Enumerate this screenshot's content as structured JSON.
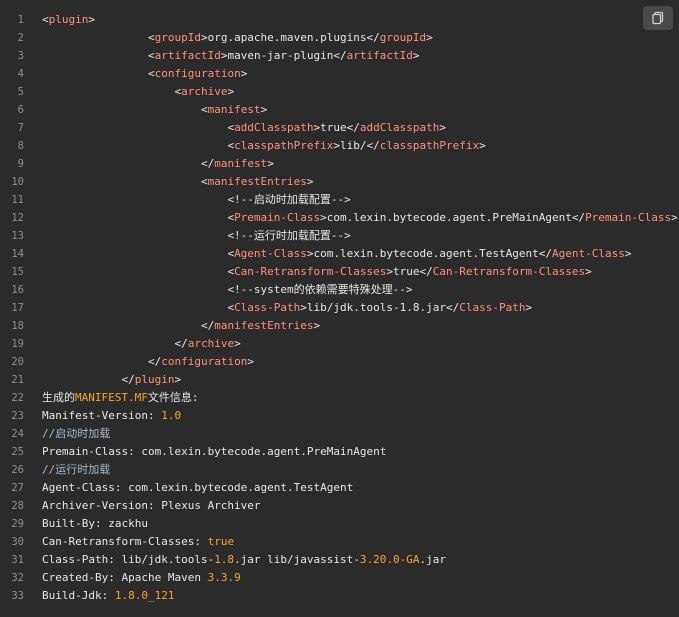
{
  "copy_icon": "copy-icon",
  "colors": {
    "background": "#2b2b2b",
    "tag": "#ff8f7a",
    "number": "#f5a623",
    "text": "#e6e6e6",
    "line_number": "#8e8e8e"
  },
  "lines": [
    {
      "n": "1",
      "indent": "",
      "tok": [
        [
          "p",
          "<"
        ],
        [
          "t",
          "plugin"
        ],
        [
          "p",
          ">"
        ]
      ]
    },
    {
      "n": "2",
      "indent": "                ",
      "tok": [
        [
          "p",
          "<"
        ],
        [
          "t",
          "groupId"
        ],
        [
          "p",
          ">org.apache.maven.plugins</"
        ],
        [
          "t",
          "groupId"
        ],
        [
          "p",
          ">"
        ]
      ]
    },
    {
      "n": "3",
      "indent": "                ",
      "tok": [
        [
          "p",
          "<"
        ],
        [
          "t",
          "artifactId"
        ],
        [
          "p",
          ">maven-jar-plugin</"
        ],
        [
          "t",
          "artifactId"
        ],
        [
          "p",
          ">"
        ]
      ]
    },
    {
      "n": "4",
      "indent": "                ",
      "tok": [
        [
          "p",
          "<"
        ],
        [
          "t",
          "configuration"
        ],
        [
          "p",
          ">"
        ]
      ]
    },
    {
      "n": "5",
      "indent": "                    ",
      "tok": [
        [
          "p",
          "<"
        ],
        [
          "t",
          "archive"
        ],
        [
          "p",
          ">"
        ]
      ]
    },
    {
      "n": "6",
      "indent": "                        ",
      "tok": [
        [
          "p",
          "<"
        ],
        [
          "t",
          "manifest"
        ],
        [
          "p",
          ">"
        ]
      ]
    },
    {
      "n": "7",
      "indent": "                            ",
      "tok": [
        [
          "p",
          "<"
        ],
        [
          "t",
          "addClasspath"
        ],
        [
          "p",
          ">true</"
        ],
        [
          "t",
          "addClasspath"
        ],
        [
          "p",
          ">"
        ]
      ]
    },
    {
      "n": "8",
      "indent": "                            ",
      "tok": [
        [
          "p",
          "<"
        ],
        [
          "t",
          "classpathPrefix"
        ],
        [
          "p",
          ">lib/</"
        ],
        [
          "t",
          "classpathPrefix"
        ],
        [
          "p",
          ">"
        ]
      ]
    },
    {
      "n": "9",
      "indent": "                        ",
      "tok": [
        [
          "p",
          "</"
        ],
        [
          "t",
          "manifest"
        ],
        [
          "p",
          ">"
        ]
      ]
    },
    {
      "n": "10",
      "indent": "                        ",
      "tok": [
        [
          "p",
          "<"
        ],
        [
          "t",
          "manifestEntries"
        ],
        [
          "p",
          ">"
        ]
      ]
    },
    {
      "n": "11",
      "indent": "                            ",
      "tok": [
        [
          "c",
          "<!--启动时加载配置-->"
        ]
      ]
    },
    {
      "n": "12",
      "indent": "                            ",
      "tok": [
        [
          "p",
          "<"
        ],
        [
          "t",
          "Premain-Class"
        ],
        [
          "p",
          ">com.lexin.bytecode.agent.PreMainAgent</"
        ],
        [
          "t",
          "Premain-Class"
        ],
        [
          "p",
          ">"
        ]
      ]
    },
    {
      "n": "13",
      "indent": "                            ",
      "tok": [
        [
          "c",
          "<!--运行时加载配置-->"
        ]
      ]
    },
    {
      "n": "14",
      "indent": "                            ",
      "tok": [
        [
          "p",
          "<"
        ],
        [
          "t",
          "Agent-Class"
        ],
        [
          "p",
          ">com.lexin.bytecode.agent.TestAgent</"
        ],
        [
          "t",
          "Agent-Class"
        ],
        [
          "p",
          ">"
        ]
      ]
    },
    {
      "n": "15",
      "indent": "                            ",
      "tok": [
        [
          "p",
          "<"
        ],
        [
          "t",
          "Can-Retransform-Classes"
        ],
        [
          "p",
          ">true</"
        ],
        [
          "t",
          "Can-Retransform-Classes"
        ],
        [
          "p",
          ">"
        ]
      ]
    },
    {
      "n": "16",
      "indent": "                            ",
      "tok": [
        [
          "c",
          "<!--system的依赖需要特殊处理-->"
        ]
      ]
    },
    {
      "n": "17",
      "indent": "                            ",
      "tok": [
        [
          "p",
          "<"
        ],
        [
          "t",
          "Class-Path"
        ],
        [
          "p",
          ">lib/jdk.tools-1.8.jar</"
        ],
        [
          "t",
          "Class-Path"
        ],
        [
          "p",
          ">"
        ]
      ]
    },
    {
      "n": "18",
      "indent": "                        ",
      "tok": [
        [
          "p",
          "</"
        ],
        [
          "t",
          "manifestEntries"
        ],
        [
          "p",
          ">"
        ]
      ]
    },
    {
      "n": "19",
      "indent": "                    ",
      "tok": [
        [
          "p",
          "</"
        ],
        [
          "t",
          "archive"
        ],
        [
          "p",
          ">"
        ]
      ]
    },
    {
      "n": "20",
      "indent": "                ",
      "tok": [
        [
          "p",
          "</"
        ],
        [
          "t",
          "configuration"
        ],
        [
          "p",
          ">"
        ]
      ]
    },
    {
      "n": "21",
      "indent": "            ",
      "tok": [
        [
          "p",
          "</"
        ],
        [
          "t",
          "plugin"
        ],
        [
          "p",
          ">"
        ]
      ]
    },
    {
      "n": "22",
      "indent": "",
      "tok": [
        [
          "p",
          "生成的"
        ],
        [
          "n",
          "MANIFEST.MF"
        ],
        [
          "p",
          "文件信息:"
        ]
      ]
    },
    {
      "n": "23",
      "indent": "",
      "tok": [
        [
          "p",
          "Manifest-Version: "
        ],
        [
          "n",
          "1.0"
        ]
      ]
    },
    {
      "n": "24",
      "indent": "",
      "tok": [
        [
          "m",
          "//启动时加载"
        ]
      ]
    },
    {
      "n": "25",
      "indent": "",
      "tok": [
        [
          "p",
          "Premain-Class: com.lexin.bytecode.agent.PreMainAgent"
        ]
      ]
    },
    {
      "n": "26",
      "indent": "",
      "tok": [
        [
          "m",
          "//运行时加载"
        ]
      ]
    },
    {
      "n": "27",
      "indent": "",
      "tok": [
        [
          "p",
          "Agent-Class: com.lexin.bytecode.agent.TestAgent"
        ]
      ]
    },
    {
      "n": "28",
      "indent": "",
      "tok": [
        [
          "p",
          "Archiver-Version: Plexus Archiver"
        ]
      ]
    },
    {
      "n": "29",
      "indent": "",
      "tok": [
        [
          "p",
          "Built-By: zackhu"
        ]
      ]
    },
    {
      "n": "30",
      "indent": "",
      "tok": [
        [
          "p",
          "Can-Retransform-Classes: "
        ],
        [
          "n",
          "true"
        ]
      ]
    },
    {
      "n": "31",
      "indent": "",
      "tok": [
        [
          "p",
          "Class-Path: lib/jdk.tools-"
        ],
        [
          "n",
          "1.8"
        ],
        [
          "p",
          ".jar lib/javassist-"
        ],
        [
          "n",
          "3.20.0-GA"
        ],
        [
          "p",
          ".jar"
        ]
      ]
    },
    {
      "n": "32",
      "indent": "",
      "tok": [
        [
          "p",
          "Created-By: Apache Maven "
        ],
        [
          "n",
          "3.3.9"
        ]
      ]
    },
    {
      "n": "33",
      "indent": "",
      "tok": [
        [
          "p",
          "Build-Jdk: "
        ],
        [
          "n",
          "1.8.0_121"
        ]
      ]
    }
  ]
}
